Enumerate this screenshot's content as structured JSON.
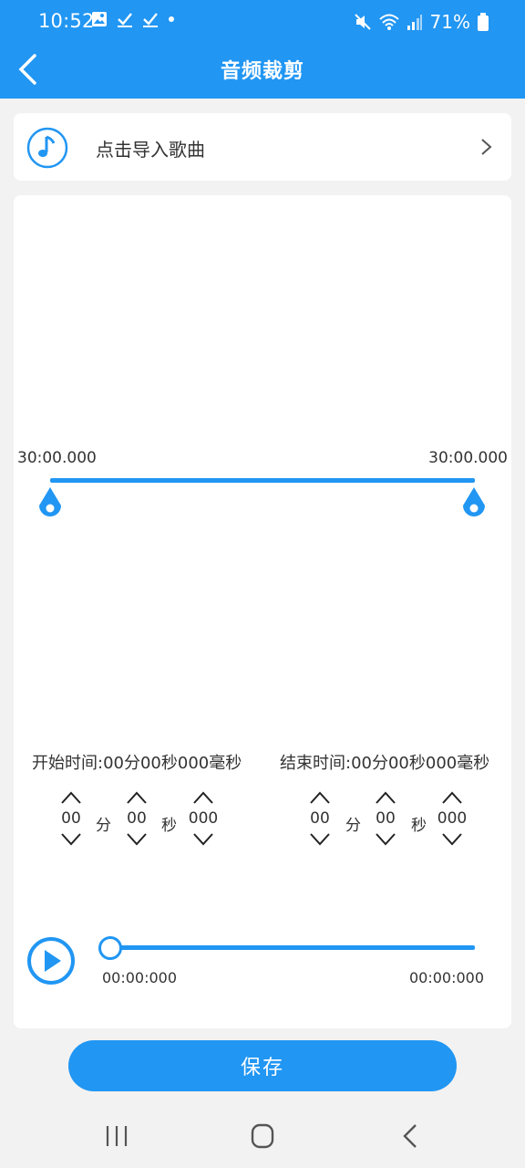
{
  "status_bar": {
    "time": "10:52",
    "battery": "71%",
    "icons_left": [
      "gallery-icon",
      "check-icon",
      "check-icon",
      "dot-icon"
    ],
    "icons_right": [
      "mute-icon",
      "wifi-icon",
      "signal-icon",
      "battery-icon"
    ]
  },
  "header": {
    "title": "音频裁剪"
  },
  "import": {
    "label": "点击导入歌曲"
  },
  "range": {
    "left_time": "30:00.000",
    "right_time": "30:00.000"
  },
  "start": {
    "summary": "开始时间:00分00秒000毫秒",
    "minutes": "00",
    "seconds": "00",
    "milliseconds": "000",
    "unit_min": "分",
    "unit_sec": "秒"
  },
  "end": {
    "summary": "结束时间:00分00秒000毫秒",
    "minutes": "00",
    "seconds": "00",
    "milliseconds": "000",
    "unit_min": "分",
    "unit_sec": "秒"
  },
  "player": {
    "current": "00:00:000",
    "total": "00:00:000"
  },
  "save_label": "保存",
  "colors": {
    "accent": "#2196f3",
    "background": "#f2f2f2",
    "card": "#ffffff"
  }
}
